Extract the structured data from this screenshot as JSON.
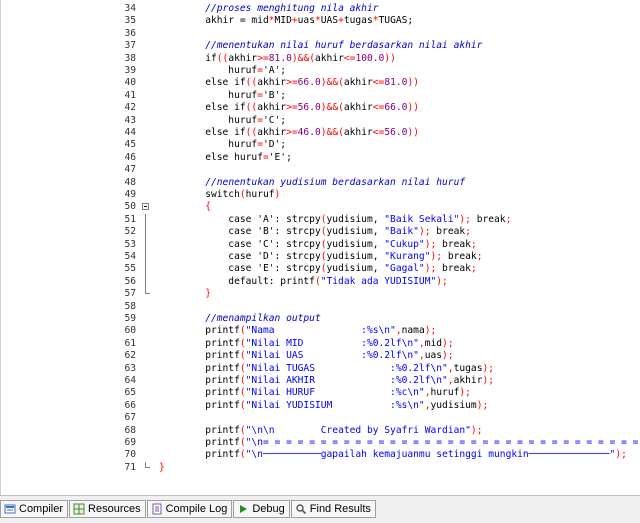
{
  "editor": {
    "lines": [
      {
        "n": "34",
        "tokens": [
          {
            "t": "        ",
            "c": "default"
          },
          {
            "t": "//proses menghitung nila akhir",
            "c": "comment"
          }
        ]
      },
      {
        "n": "35",
        "tokens": [
          {
            "t": "        akhir = mid",
            "c": "default"
          },
          {
            "t": "*",
            "c": "symbol"
          },
          {
            "t": "MID",
            "c": "default"
          },
          {
            "t": "+",
            "c": "symbol"
          },
          {
            "t": "uas",
            "c": "default"
          },
          {
            "t": "*",
            "c": "symbol"
          },
          {
            "t": "UAS",
            "c": "default"
          },
          {
            "t": "+",
            "c": "symbol"
          },
          {
            "t": "tugas",
            "c": "default"
          },
          {
            "t": "*",
            "c": "symbol"
          },
          {
            "t": "TUGAS;",
            "c": "default"
          }
        ]
      },
      {
        "n": "36",
        "tokens": []
      },
      {
        "n": "37",
        "tokens": [
          {
            "t": "        ",
            "c": "default"
          },
          {
            "t": "//menentukan nilai huruf berdasarkan nilai akhir",
            "c": "comment"
          }
        ]
      },
      {
        "n": "38",
        "tokens": [
          {
            "t": "        if",
            "c": "default"
          },
          {
            "t": "((",
            "c": "symbol"
          },
          {
            "t": "akhir",
            "c": "default"
          },
          {
            "t": ">=",
            "c": "symbol"
          },
          {
            "t": "81.0",
            "c": "number"
          },
          {
            "t": ")&&(",
            "c": "symbol"
          },
          {
            "t": "akhir",
            "c": "default"
          },
          {
            "t": "<=",
            "c": "symbol"
          },
          {
            "t": "100.0",
            "c": "number"
          },
          {
            "t": "))",
            "c": "symbol"
          }
        ]
      },
      {
        "n": "39",
        "tokens": [
          {
            "t": "            huruf",
            "c": "default"
          },
          {
            "t": "=",
            "c": "symbol"
          },
          {
            "t": "'A';",
            "c": "default"
          }
        ]
      },
      {
        "n": "40",
        "tokens": [
          {
            "t": "        else if",
            "c": "default"
          },
          {
            "t": "((",
            "c": "symbol"
          },
          {
            "t": "akhir",
            "c": "default"
          },
          {
            "t": ">=",
            "c": "symbol"
          },
          {
            "t": "66.0",
            "c": "number"
          },
          {
            "t": ")&&(",
            "c": "symbol"
          },
          {
            "t": "akhir",
            "c": "default"
          },
          {
            "t": "<=",
            "c": "symbol"
          },
          {
            "t": "81.0",
            "c": "number"
          },
          {
            "t": "))",
            "c": "symbol"
          }
        ]
      },
      {
        "n": "41",
        "tokens": [
          {
            "t": "            huruf",
            "c": "default"
          },
          {
            "t": "=",
            "c": "symbol"
          },
          {
            "t": "'B';",
            "c": "default"
          }
        ]
      },
      {
        "n": "42",
        "tokens": [
          {
            "t": "        else if",
            "c": "default"
          },
          {
            "t": "((",
            "c": "symbol"
          },
          {
            "t": "akhir",
            "c": "default"
          },
          {
            "t": ">=",
            "c": "symbol"
          },
          {
            "t": "56.0",
            "c": "number"
          },
          {
            "t": ")&&(",
            "c": "symbol"
          },
          {
            "t": "akhir",
            "c": "default"
          },
          {
            "t": "<=",
            "c": "symbol"
          },
          {
            "t": "66.0",
            "c": "number"
          },
          {
            "t": "))",
            "c": "symbol"
          }
        ]
      },
      {
        "n": "43",
        "tokens": [
          {
            "t": "            huruf",
            "c": "default"
          },
          {
            "t": "=",
            "c": "symbol"
          },
          {
            "t": "'C';",
            "c": "default"
          }
        ]
      },
      {
        "n": "44",
        "tokens": [
          {
            "t": "        else if",
            "c": "default"
          },
          {
            "t": "((",
            "c": "symbol"
          },
          {
            "t": "akhir",
            "c": "default"
          },
          {
            "t": ">=",
            "c": "symbol"
          },
          {
            "t": "46.0",
            "c": "number"
          },
          {
            "t": ")&&(",
            "c": "symbol"
          },
          {
            "t": "akhir",
            "c": "default"
          },
          {
            "t": "<=",
            "c": "symbol"
          },
          {
            "t": "56.0",
            "c": "number"
          },
          {
            "t": "))",
            "c": "symbol"
          }
        ]
      },
      {
        "n": "45",
        "tokens": [
          {
            "t": "            huruf",
            "c": "default"
          },
          {
            "t": "=",
            "c": "symbol"
          },
          {
            "t": "'D';",
            "c": "default"
          }
        ]
      },
      {
        "n": "46",
        "tokens": [
          {
            "t": "        else huruf",
            "c": "default"
          },
          {
            "t": "=",
            "c": "symbol"
          },
          {
            "t": "'E';",
            "c": "default"
          }
        ]
      },
      {
        "n": "47",
        "tokens": []
      },
      {
        "n": "48",
        "tokens": [
          {
            "t": "        ",
            "c": "default"
          },
          {
            "t": "//nenentukan yudisium berdasarkan nilai huruf",
            "c": "comment"
          }
        ]
      },
      {
        "n": "49",
        "tokens": [
          {
            "t": "        switch",
            "c": "default"
          },
          {
            "t": "(",
            "c": "symbol"
          },
          {
            "t": "huruf",
            "c": "default"
          },
          {
            "t": ")",
            "c": "symbol"
          }
        ]
      },
      {
        "n": "50",
        "fold": "open",
        "tokens": [
          {
            "t": "        ",
            "c": "default"
          },
          {
            "t": "{",
            "c": "symbol"
          }
        ]
      },
      {
        "n": "51",
        "fold": "line",
        "tokens": [
          {
            "t": "            case 'A': strcpy",
            "c": "default"
          },
          {
            "t": "(",
            "c": "symbol"
          },
          {
            "t": "yudisium, ",
            "c": "default"
          },
          {
            "t": "\"Baik Sekali\"",
            "c": "string"
          },
          {
            "t": "); ",
            "c": "symbol"
          },
          {
            "t": "break",
            "c": "default"
          },
          {
            "t": ";",
            "c": "symbol"
          }
        ]
      },
      {
        "n": "52",
        "fold": "line",
        "tokens": [
          {
            "t": "            case 'B': strcpy",
            "c": "default"
          },
          {
            "t": "(",
            "c": "symbol"
          },
          {
            "t": "yudisium, ",
            "c": "default"
          },
          {
            "t": "\"Baik\"",
            "c": "string"
          },
          {
            "t": "); ",
            "c": "symbol"
          },
          {
            "t": "break",
            "c": "default"
          },
          {
            "t": ";",
            "c": "symbol"
          }
        ]
      },
      {
        "n": "53",
        "fold": "line",
        "tokens": [
          {
            "t": "            case 'C': strcpy",
            "c": "default"
          },
          {
            "t": "(",
            "c": "symbol"
          },
          {
            "t": "yudisium, ",
            "c": "default"
          },
          {
            "t": "\"Cukup\"",
            "c": "string"
          },
          {
            "t": "); ",
            "c": "symbol"
          },
          {
            "t": "break",
            "c": "default"
          },
          {
            "t": ";",
            "c": "symbol"
          }
        ]
      },
      {
        "n": "54",
        "fold": "line",
        "tokens": [
          {
            "t": "            case 'D': strcpy",
            "c": "default"
          },
          {
            "t": "(",
            "c": "symbol"
          },
          {
            "t": "yudisium, ",
            "c": "default"
          },
          {
            "t": "\"Kurang\"",
            "c": "string"
          },
          {
            "t": "); ",
            "c": "symbol"
          },
          {
            "t": "break",
            "c": "default"
          },
          {
            "t": ";",
            "c": "symbol"
          }
        ]
      },
      {
        "n": "55",
        "fold": "line",
        "tokens": [
          {
            "t": "            case 'E': strcpy",
            "c": "default"
          },
          {
            "t": "(",
            "c": "symbol"
          },
          {
            "t": "yudisium, ",
            "c": "default"
          },
          {
            "t": "\"Gagal\"",
            "c": "string"
          },
          {
            "t": "); ",
            "c": "symbol"
          },
          {
            "t": "break",
            "c": "default"
          },
          {
            "t": ";",
            "c": "symbol"
          }
        ]
      },
      {
        "n": "56",
        "fold": "line",
        "tokens": [
          {
            "t": "            default: printf",
            "c": "default"
          },
          {
            "t": "(",
            "c": "symbol"
          },
          {
            "t": "\"Tidak ada YUDISIUM\"",
            "c": "string"
          },
          {
            "t": ");",
            "c": "symbol"
          }
        ]
      },
      {
        "n": "57",
        "fold": "end",
        "tokens": [
          {
            "t": "        ",
            "c": "default"
          },
          {
            "t": "}",
            "c": "symbol"
          }
        ]
      },
      {
        "n": "58",
        "tokens": []
      },
      {
        "n": "59",
        "tokens": [
          {
            "t": "        ",
            "c": "default"
          },
          {
            "t": "//menampilkan output",
            "c": "comment"
          }
        ]
      },
      {
        "n": "60",
        "tokens": [
          {
            "t": "        printf",
            "c": "default"
          },
          {
            "t": "(",
            "c": "symbol"
          },
          {
            "t": "\"Nama               :%s\\n\"",
            "c": "string"
          },
          {
            "t": ",",
            "c": "symbol"
          },
          {
            "t": "nama",
            "c": "default"
          },
          {
            "t": ");",
            "c": "symbol"
          }
        ]
      },
      {
        "n": "61",
        "tokens": [
          {
            "t": "        printf",
            "c": "default"
          },
          {
            "t": "(",
            "c": "symbol"
          },
          {
            "t": "\"Nilai MID          :%0.2lf\\n\"",
            "c": "string"
          },
          {
            "t": ",",
            "c": "symbol"
          },
          {
            "t": "mid",
            "c": "default"
          },
          {
            "t": ");",
            "c": "symbol"
          }
        ]
      },
      {
        "n": "62",
        "tokens": [
          {
            "t": "        printf",
            "c": "default"
          },
          {
            "t": "(",
            "c": "symbol"
          },
          {
            "t": "\"Nilai UAS          :%0.2lf\\n\"",
            "c": "string"
          },
          {
            "t": ",",
            "c": "symbol"
          },
          {
            "t": "uas",
            "c": "default"
          },
          {
            "t": ");",
            "c": "symbol"
          }
        ]
      },
      {
        "n": "63",
        "tokens": [
          {
            "t": "        printf",
            "c": "default"
          },
          {
            "t": "(",
            "c": "symbol"
          },
          {
            "t": "\"Nilai TUGAS             :%0.2lf\\n\"",
            "c": "string"
          },
          {
            "t": ",",
            "c": "symbol"
          },
          {
            "t": "tugas",
            "c": "default"
          },
          {
            "t": ");",
            "c": "symbol"
          }
        ]
      },
      {
        "n": "64",
        "tokens": [
          {
            "t": "        printf",
            "c": "default"
          },
          {
            "t": "(",
            "c": "symbol"
          },
          {
            "t": "\"Nilai AKHIR             :%0.2lf\\n\"",
            "c": "string"
          },
          {
            "t": ",",
            "c": "symbol"
          },
          {
            "t": "akhir",
            "c": "default"
          },
          {
            "t": ");",
            "c": "symbol"
          }
        ]
      },
      {
        "n": "65",
        "tokens": [
          {
            "t": "        printf",
            "c": "default"
          },
          {
            "t": "(",
            "c": "symbol"
          },
          {
            "t": "\"Nilai HURUF             :%c\\n\"",
            "c": "string"
          },
          {
            "t": ",",
            "c": "symbol"
          },
          {
            "t": "huruf",
            "c": "default"
          },
          {
            "t": ");",
            "c": "symbol"
          }
        ]
      },
      {
        "n": "66",
        "tokens": [
          {
            "t": "        printf",
            "c": "default"
          },
          {
            "t": "(",
            "c": "symbol"
          },
          {
            "t": "\"Nilai YUDISIUM          :%s\\n\"",
            "c": "string"
          },
          {
            "t": ",",
            "c": "symbol"
          },
          {
            "t": "yudisium",
            "c": "default"
          },
          {
            "t": ");",
            "c": "symbol"
          }
        ]
      },
      {
        "n": "67",
        "tokens": []
      },
      {
        "n": "68",
        "tokens": [
          {
            "t": "        printf",
            "c": "default"
          },
          {
            "t": "(",
            "c": "symbol"
          },
          {
            "t": "\"\\n\\n        Created by Syafri Wardian\"",
            "c": "string"
          },
          {
            "t": ");",
            "c": "symbol"
          }
        ]
      },
      {
        "n": "69",
        "tokens": [
          {
            "t": "        printf",
            "c": "default"
          },
          {
            "t": "(",
            "c": "symbol"
          },
          {
            "t": "\"\\n= = = = = = = = = = = = = = = = = = = = = = = = = = = = = = = = = = =\"",
            "c": "string"
          },
          {
            "t": ");",
            "c": "symbol"
          }
        ]
      },
      {
        "n": "70",
        "tokens": [
          {
            "t": "        printf",
            "c": "default"
          },
          {
            "t": "(",
            "c": "symbol"
          },
          {
            "t": "\"\\n──────────gapailah kemajuanmu setinggi mungkin──────────────\"",
            "c": "string"
          },
          {
            "t": ");",
            "c": "symbol"
          }
        ]
      },
      {
        "n": "71",
        "fold": "end",
        "tokens": [
          {
            "t": "}",
            "c": "symbol"
          }
        ]
      }
    ]
  },
  "bottom_tabs": [
    {
      "label": "Compiler",
      "icon": "compiler-icon",
      "color": "#3a6fc4"
    },
    {
      "label": "Resources",
      "icon": "resources-icon",
      "color": "#4a8a3a"
    },
    {
      "label": "Compile Log",
      "icon": "compile-log-icon",
      "color": "#7a5aa8"
    },
    {
      "label": "Debug",
      "icon": "debug-icon",
      "color": "#2a8a2a"
    },
    {
      "label": "Find Results",
      "icon": "find-results-icon",
      "color": "#555555"
    }
  ]
}
